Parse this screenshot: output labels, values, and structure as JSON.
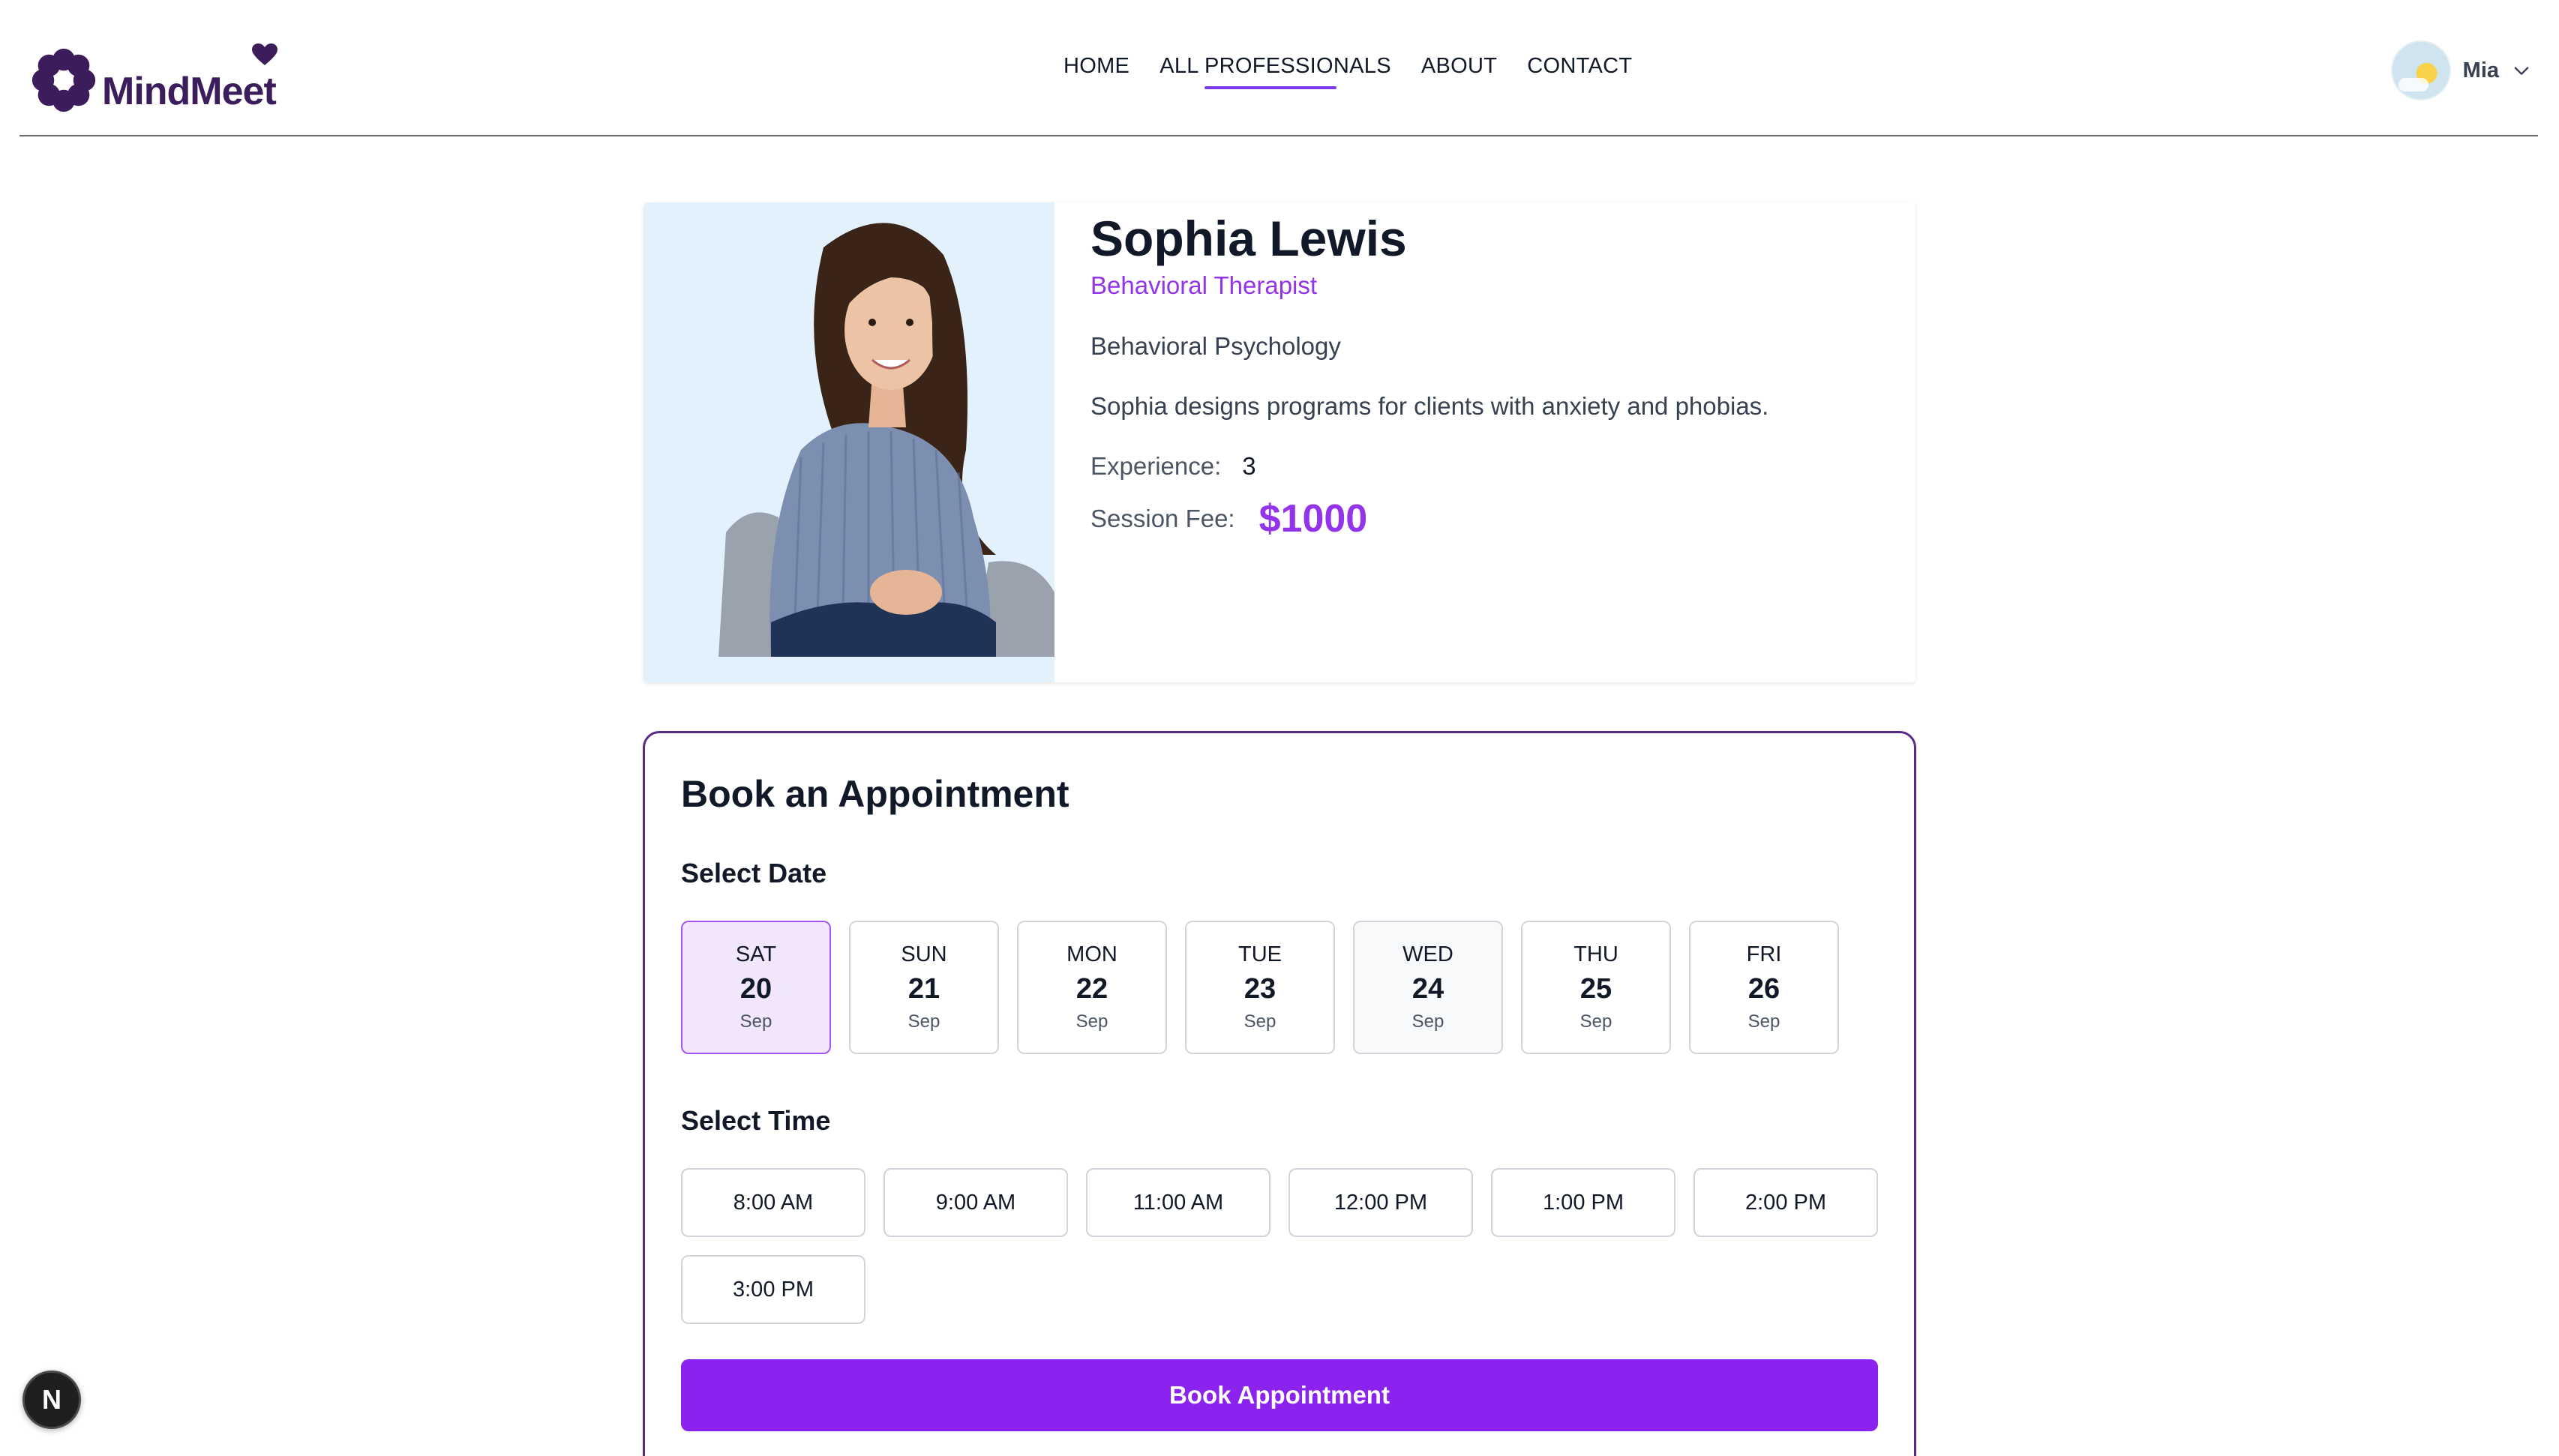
{
  "brand": {
    "name": "MindMeet",
    "color": "#3b1d5c"
  },
  "nav": {
    "items": [
      {
        "label": "HOME",
        "active": false
      },
      {
        "label": "ALL PROFESSIONALS",
        "active": true
      },
      {
        "label": "ABOUT",
        "active": false
      },
      {
        "label": "CONTACT",
        "active": false
      }
    ]
  },
  "user": {
    "name": "Mia",
    "icon": "chevron-down-icon"
  },
  "professional": {
    "name": "Sophia Lewis",
    "title": "Behavioral Therapist",
    "speciality": "Behavioral Psychology",
    "about": "Sophia designs programs for clients with anxiety and phobias.",
    "experience_label": "Experience:",
    "experience_value": "3",
    "fee_label": "Session Fee:",
    "fee_value": "$1000"
  },
  "booking": {
    "title": "Book an Appointment",
    "select_date_label": "Select Date",
    "dates": [
      {
        "dow": "SAT",
        "day": "20",
        "month": "Sep",
        "selected": true
      },
      {
        "dow": "SUN",
        "day": "21",
        "month": "Sep",
        "selected": false
      },
      {
        "dow": "MON",
        "day": "22",
        "month": "Sep",
        "selected": false
      },
      {
        "dow": "TUE",
        "day": "23",
        "month": "Sep",
        "selected": false
      },
      {
        "dow": "WED",
        "day": "24",
        "month": "Sep",
        "selected": false
      },
      {
        "dow": "THU",
        "day": "25",
        "month": "Sep",
        "selected": false
      },
      {
        "dow": "FRI",
        "day": "26",
        "month": "Sep",
        "selected": false
      }
    ],
    "select_time_label": "Select Time",
    "times": [
      "8:00 AM",
      "9:00 AM",
      "11:00 AM",
      "12:00 PM",
      "1:00 PM",
      "2:00 PM",
      "3:00 PM"
    ],
    "button_label": "Book Appointment"
  },
  "badge": {
    "label": "N"
  },
  "colors": {
    "accent": "#9333ea",
    "button": "#8b22ee",
    "selected_bg": "#f1e6fc",
    "card_border": "#5b2a86"
  }
}
